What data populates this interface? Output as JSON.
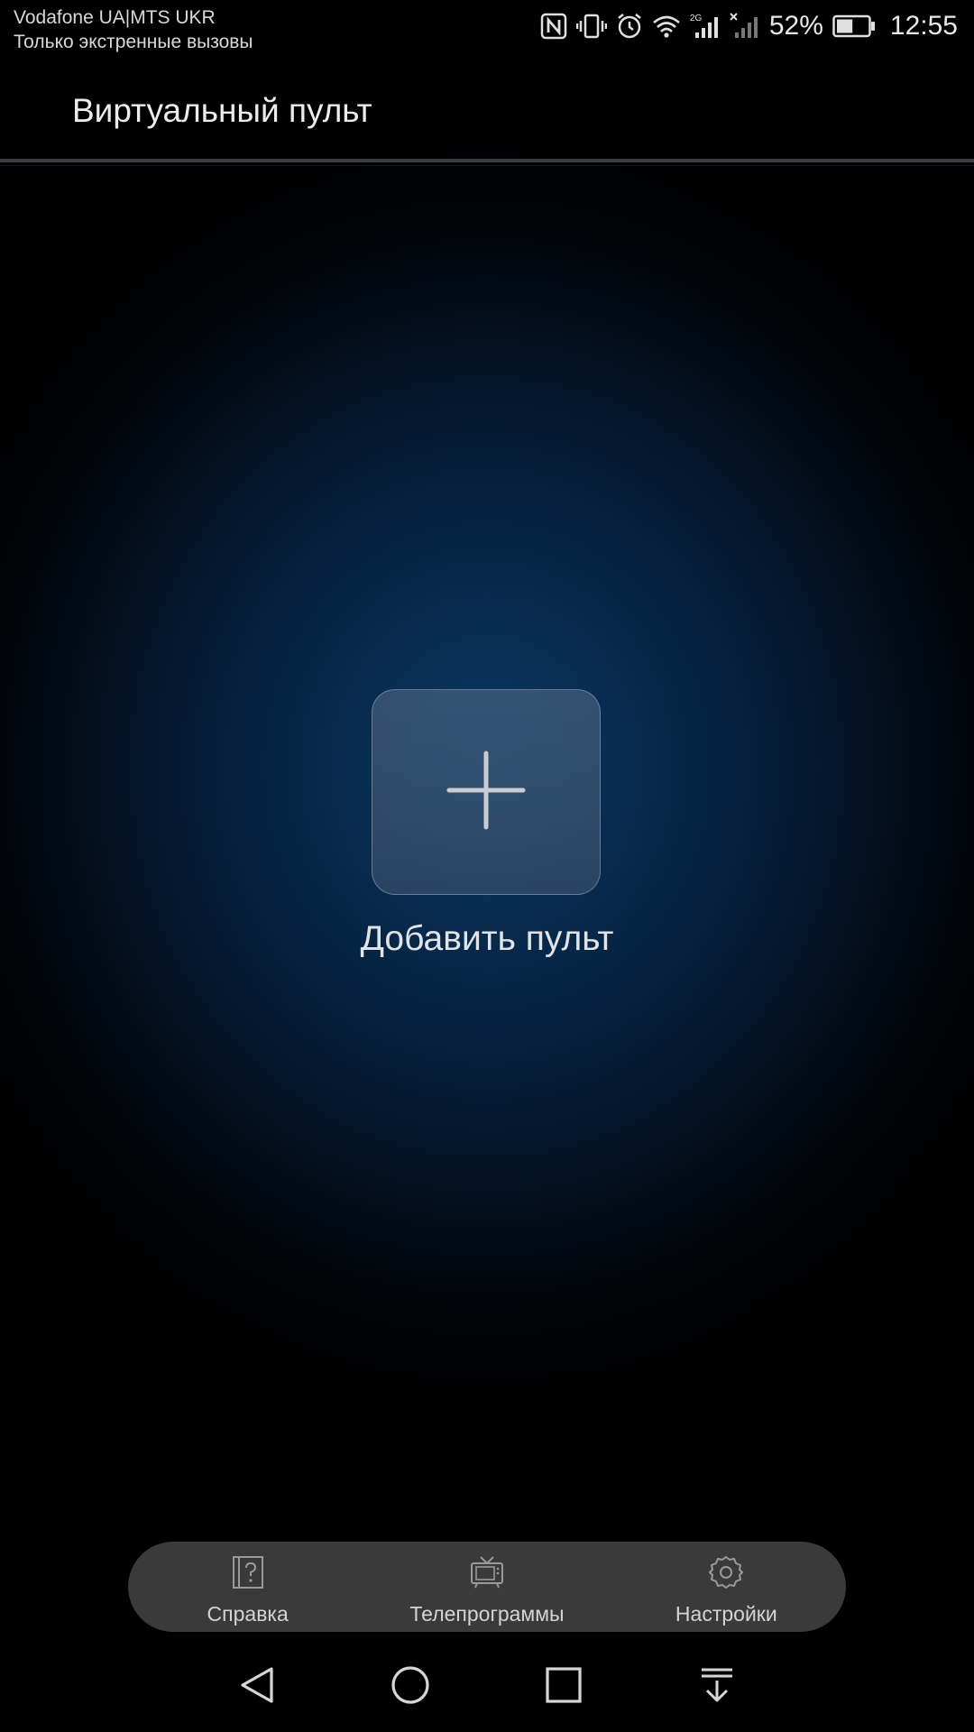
{
  "status_bar": {
    "carrier_line1": "Vodafone UA|MTS UKR",
    "carrier_line2": "Только экстренные вызовы",
    "network_type": "2G",
    "battery_percent": "52%",
    "battery_level": 0.52,
    "time": "12:55",
    "icons": [
      "nfc-icon",
      "vibrate-icon",
      "alarm-icon",
      "wifi-icon",
      "signal-icon",
      "signal-no-sim-icon",
      "battery-icon"
    ]
  },
  "header": {
    "title": "Виртуальный пульт"
  },
  "main": {
    "add_remote_label": "Добавить пульт",
    "add_icon": "plus-icon"
  },
  "toolbar": {
    "items": [
      {
        "label": "Справка",
        "icon": "help-book-icon"
      },
      {
        "label": "Телепрограммы",
        "icon": "tv-icon"
      },
      {
        "label": "Настройки",
        "icon": "gear-icon"
      }
    ]
  },
  "nav_bar": {
    "buttons": [
      "back-icon",
      "home-icon",
      "recents-icon",
      "notification-drawer-icon"
    ]
  },
  "colors": {
    "background_glow": "#0b3a66",
    "toolbar_bg": "#3a3a3b",
    "text": "#e0e4e8"
  }
}
